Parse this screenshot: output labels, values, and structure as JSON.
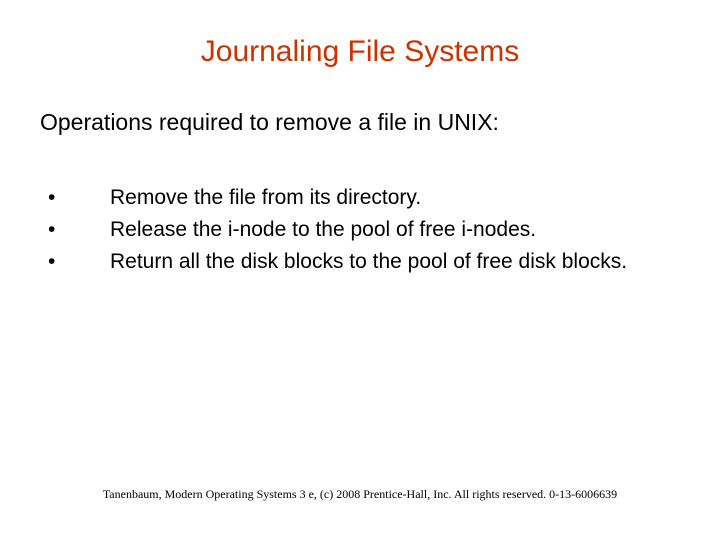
{
  "title": "Journaling File Systems",
  "subtitle": "Operations required to remove a file in UNIX:",
  "bullets": [
    "Remove the file from its directory.",
    "Release the i-node to the pool of free i-nodes.",
    "Return all the disk blocks to the pool of free disk blocks."
  ],
  "footer": "Tanenbaum, Modern Operating Systems 3 e, (c) 2008 Prentice-Hall, Inc. All rights reserved. 0-13-6006639"
}
